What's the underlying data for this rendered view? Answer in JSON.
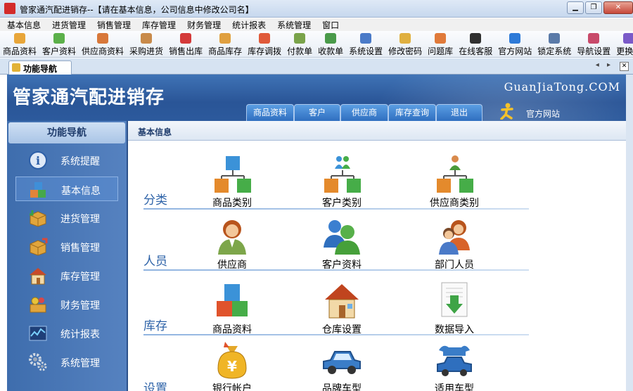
{
  "window": {
    "title": "管家通汽配进销存--【请在基本信息，公司信息中修改公司名】",
    "controls": {
      "minimize": "▁",
      "restore": "❐",
      "close": "✕"
    }
  },
  "menu": [
    "基本信息",
    "进货管理",
    "销售管理",
    "库存管理",
    "财务管理",
    "统计报表",
    "系统管理",
    "窗口"
  ],
  "toolbar": [
    {
      "label": "商品资料",
      "icon": "goods-icon",
      "color": "#e8a63a"
    },
    {
      "label": "客户资料",
      "icon": "customers-icon",
      "color": "#5bb04a"
    },
    {
      "label": "供应商资料",
      "icon": "supplier-icon",
      "color": "#d8783a"
    },
    {
      "label": "采购进货",
      "icon": "purchase-icon",
      "color": "#c88a4a"
    },
    {
      "label": "销售出库",
      "icon": "sales-icon",
      "color": "#d43a3a"
    },
    {
      "label": "商品库存",
      "icon": "stock-icon",
      "color": "#e0a040"
    },
    {
      "label": "库存调拨",
      "icon": "transfer-icon",
      "color": "#e05a3a"
    },
    {
      "label": "付款单",
      "icon": "payment-icon",
      "color": "#7aa34a"
    },
    {
      "label": "收款单",
      "icon": "receipt-icon",
      "color": "#4a9a4a"
    },
    {
      "label": "系统设置",
      "icon": "settings-icon",
      "color": "#4a7ac8"
    },
    {
      "label": "修改密码",
      "icon": "password-icon",
      "color": "#e0b040"
    },
    {
      "label": "问题库",
      "icon": "question-icon",
      "color": "#e07a3a"
    },
    {
      "label": "在线客服",
      "icon": "service-icon",
      "color": "#303030"
    },
    {
      "label": "官方网站",
      "icon": "ie-icon",
      "color": "#2d7ad8"
    },
    {
      "label": "锁定系统",
      "icon": "lock-icon",
      "color": "#5a7aa8"
    },
    {
      "label": "导航设置",
      "icon": "nav-settings-icon",
      "color": "#c84a6a"
    },
    {
      "label": "更换皮",
      "icon": "skin-icon",
      "color": "#7a5ac8"
    }
  ],
  "tab": {
    "label": "功能导航",
    "nav": "◂ ▸"
  },
  "banner": {
    "title": "管家通汽配进销存",
    "brand": "GuanJiaTong.COM",
    "quick_tabs": [
      "商品资料",
      "客户",
      "供应商",
      "库存查询",
      "退出"
    ],
    "site_link": "官方网站"
  },
  "sidebar": {
    "title": "功能导航",
    "items": [
      {
        "label": "系统提醒",
        "icon": "info-icon",
        "active": false
      },
      {
        "label": "基本信息",
        "icon": "cubes-icon",
        "active": true
      },
      {
        "label": "进货管理",
        "icon": "purchase-box-icon",
        "active": false
      },
      {
        "label": "销售管理",
        "icon": "sales-box-icon",
        "active": false
      },
      {
        "label": "库存管理",
        "icon": "warehouse-icon",
        "active": false
      },
      {
        "label": "财务管理",
        "icon": "finance-icon",
        "active": false
      },
      {
        "label": "统计报表",
        "icon": "report-icon",
        "active": false
      },
      {
        "label": "系统管理",
        "icon": "gears-icon",
        "active": false
      }
    ]
  },
  "main": {
    "breadcrumb": "基本信息",
    "sections": [
      {
        "label": "分类",
        "items": [
          "商品类别",
          "客户类别",
          "供应商类别"
        ]
      },
      {
        "label": "人员",
        "items": [
          "供应商",
          "客户资料",
          "部门人员"
        ]
      },
      {
        "label": "库存",
        "items": [
          "商品资料",
          "仓库设置",
          "数据导入"
        ]
      },
      {
        "label": "设置",
        "items": [
          "银行帐户",
          "品牌车型",
          "适用车型"
        ]
      }
    ]
  }
}
